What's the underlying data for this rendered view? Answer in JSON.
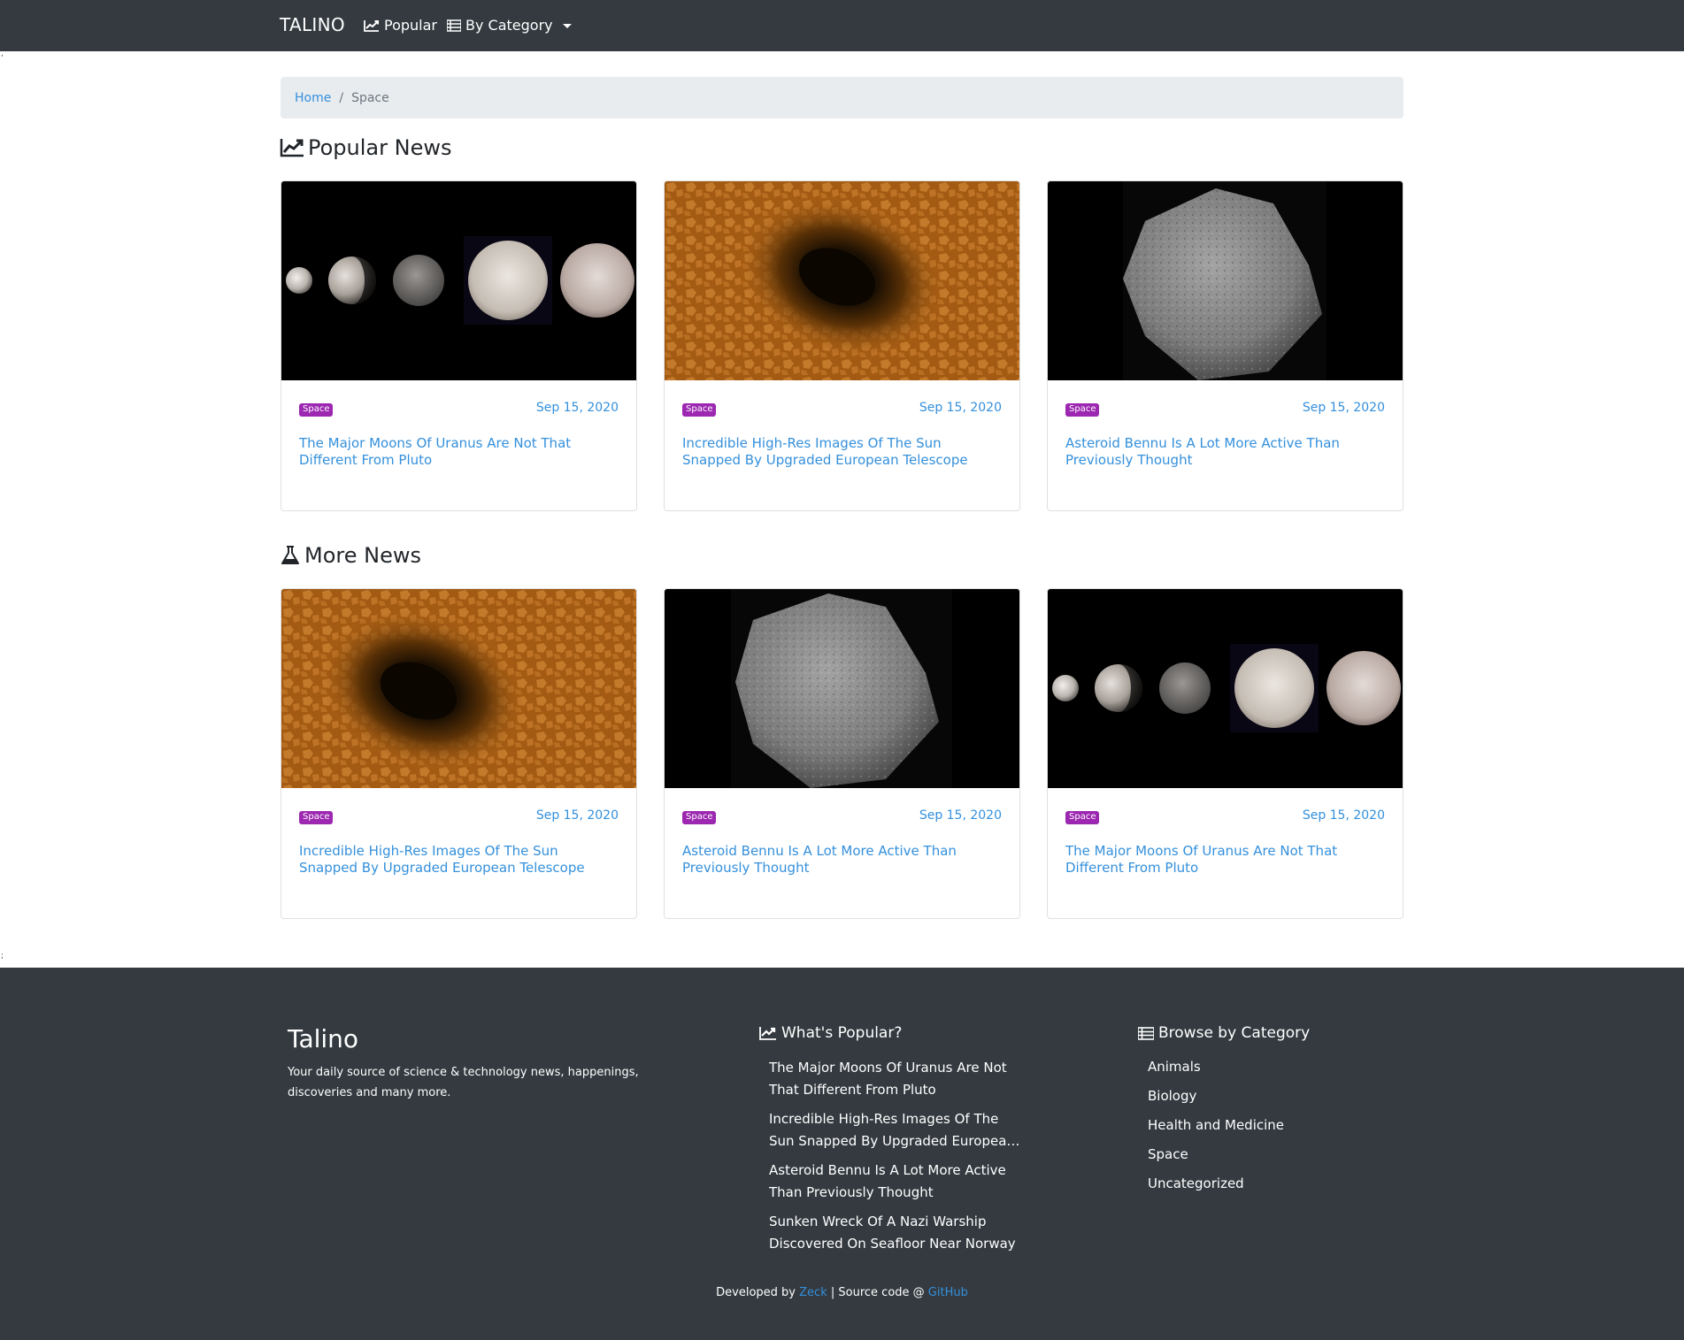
{
  "navbar": {
    "brand": "TALINO",
    "popular_label": "Popular",
    "category_label": "By Category"
  },
  "breadcrumb": {
    "home": "Home",
    "separator": "/",
    "current": "Space"
  },
  "sections": {
    "popular_title": "Popular News",
    "more_title": "More News"
  },
  "popular_cards": [
    {
      "badge": "Space",
      "date": "Sep 15, 2020",
      "title": "The Major Moons Of Uranus Are Not That Different From Pluto",
      "image": "moons-of-uranus-image"
    },
    {
      "badge": "Space",
      "date": "Sep 15, 2020",
      "title": "Incredible High-Res Images Of The Sun Snapped By Upgraded European Telescope",
      "image": "sunspot-image"
    },
    {
      "badge": "Space",
      "date": "Sep 15, 2020",
      "title": "Asteroid Bennu Is A Lot More Active Than Previously Thought",
      "image": "asteroid-bennu-image"
    }
  ],
  "more_cards": [
    {
      "badge": "Space",
      "date": "Sep 15, 2020",
      "title": "Incredible High-Res Images Of The Sun Snapped By Upgraded European Telescope",
      "image": "sunspot-image"
    },
    {
      "badge": "Space",
      "date": "Sep 15, 2020",
      "title": "Asteroid Bennu Is A Lot More Active Than Previously Thought",
      "image": "asteroid-bennu-image"
    },
    {
      "badge": "Space",
      "date": "Sep 15, 2020",
      "title": "The Major Moons Of Uranus Are Not That Different From Pluto",
      "image": "moons-of-uranus-image"
    }
  ],
  "stray_marks": {
    "top": ",",
    "bottom": ";"
  },
  "footer": {
    "brand": "Talino",
    "description": "Your daily source of science & technology news, happenings, discoveries and many more.",
    "popular_heading": "What's Popular?",
    "popular_items": [
      "The Major Moons Of Uranus Are Not That Different From Pluto",
      "Incredible High-Res Images Of The Sun Snapped By Upgraded European Telescope",
      "Asteroid Bennu Is A Lot More Active Than Previously Thought",
      "Sunken Wreck Of A Nazi Warship Discovered On Seafloor Near Norway"
    ],
    "category_heading": "Browse by Category",
    "categories": [
      "Animals",
      "Biology",
      "Health and Medicine",
      "Space",
      "Uncategorized"
    ],
    "credits_prefix": "Developed by",
    "credits_author": "Zeck",
    "credits_middle": "| Source code @",
    "credits_repo": "GitHub"
  },
  "colors": {
    "navbar_bg": "#343a40",
    "link": "#3490dc",
    "badge": "#9c27b0",
    "breadcrumb_bg": "#e9ecef"
  }
}
